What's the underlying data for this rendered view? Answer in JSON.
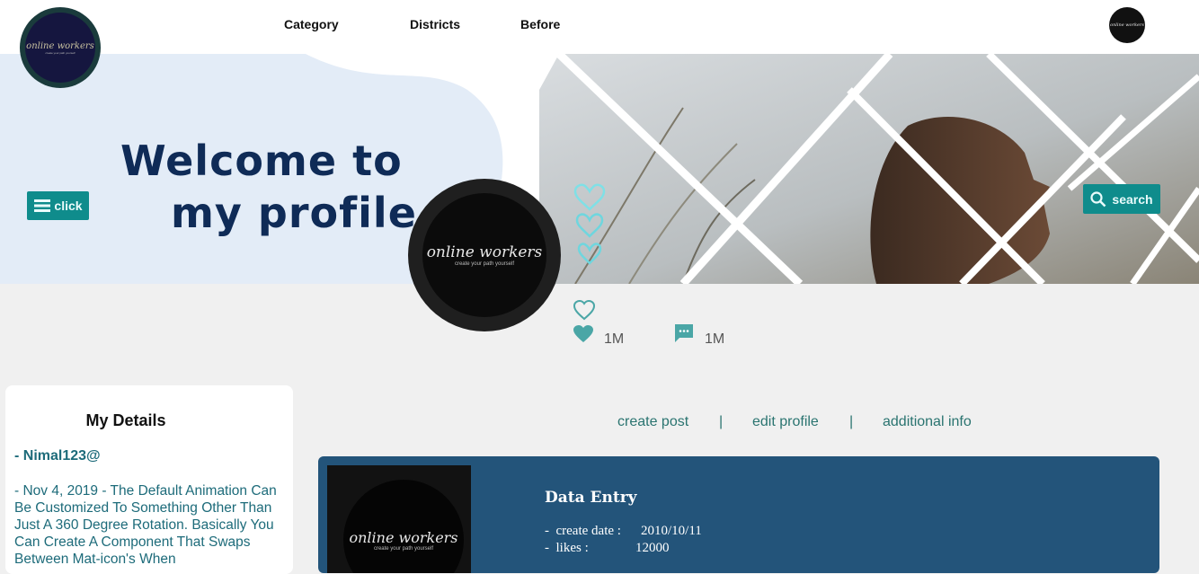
{
  "nav": {
    "items": [
      "Category",
      "Districts",
      "Before"
    ]
  },
  "brand": {
    "logo_text": "online workers",
    "tagline": "create your path yourself"
  },
  "hero": {
    "line1": "Welcome to",
    "line2": "my profile"
  },
  "buttons": {
    "click_label": "click",
    "search_label": "search"
  },
  "stats": {
    "likes": "1M",
    "comments": "1M"
  },
  "details": {
    "title": "My Details",
    "username": "-  Nimal123@",
    "text": "-  Nov 4, 2019 - The Default Animation Can Be Customized To Something Other Than Just A 360 Degree Rotation. Basically You Can Create A Component That Swaps Between Mat-icon's When"
  },
  "profile_nav": {
    "create": "create post",
    "edit": "edit profile",
    "info": "additional info",
    "separator": "|"
  },
  "post": {
    "title": "Data Entry",
    "create_label": "-  create date :",
    "create_value": "2010/10/11",
    "likes_label": "-  likes :",
    "likes_value": "12000"
  },
  "colors": {
    "accent": "#0f8c8c",
    "navy": "#0f2b57",
    "card": "#23547a",
    "link": "#2a7470",
    "heart": "#6fd6de"
  },
  "icons": {
    "menu": "menu-icon",
    "search": "search-icon",
    "heart_outline": "heart-outline-icon",
    "heart_filled": "heart-filled-icon",
    "comment": "comment-icon"
  }
}
